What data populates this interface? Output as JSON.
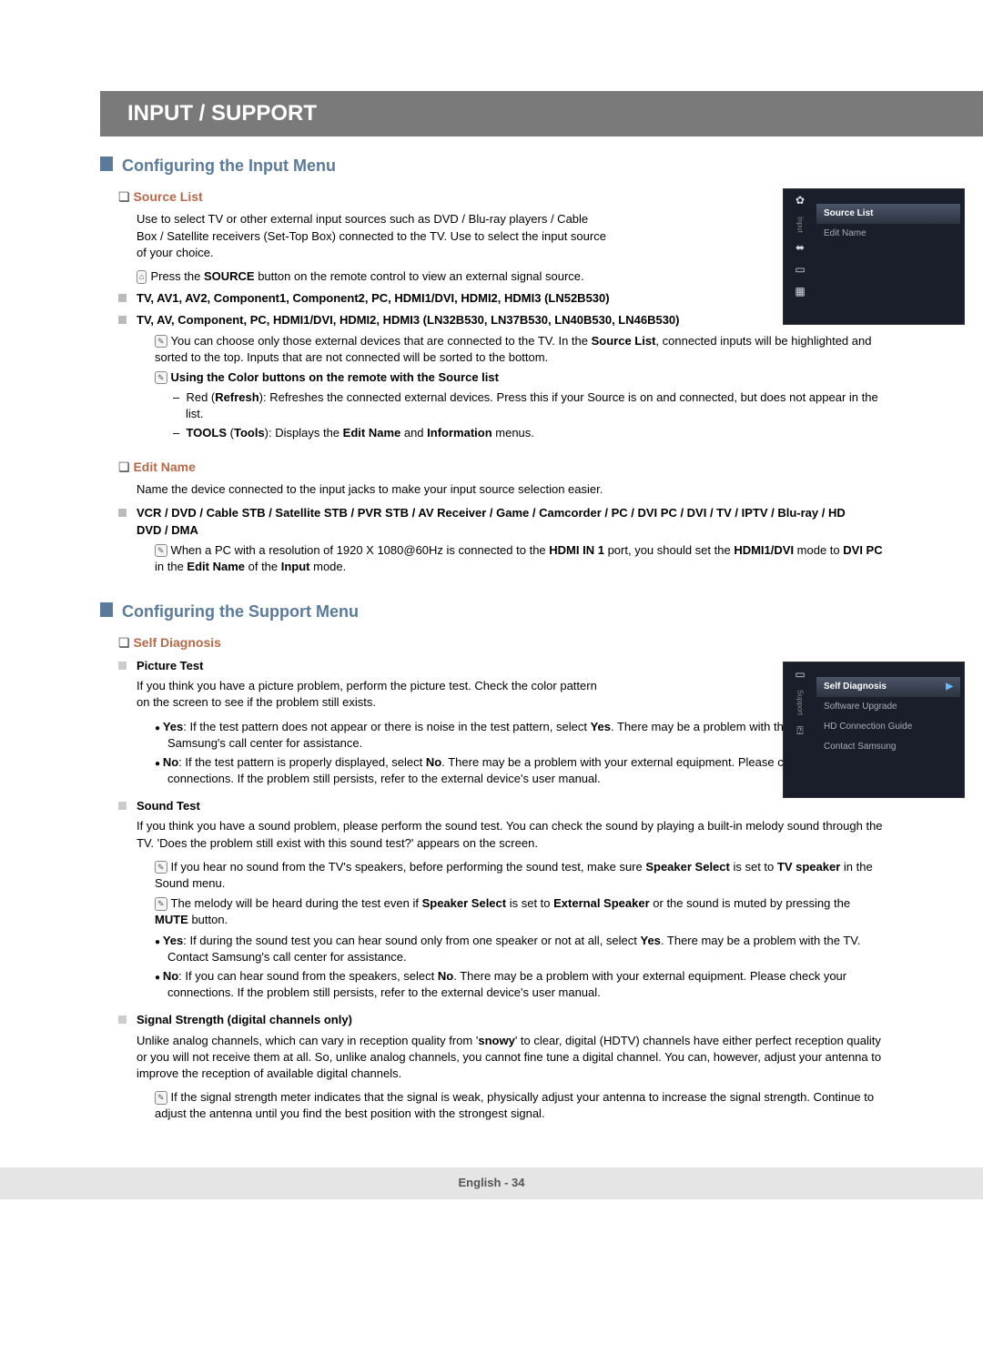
{
  "banner": "INPUT / SUPPORT",
  "section1": {
    "title": "Configuring the Input Menu",
    "source_list": {
      "head": "Source List",
      "desc": "Use to select TV or other external input sources such as DVD / Blu-ray players / Cable Box / Satellite receivers (Set-Top Box) connected to the TV. Use to select the input source of your choice.",
      "press_note": "Press the SOURCE button on the remote control to view an external signal source.",
      "list1": "TV, AV1, AV2, Component1, Component2, PC, HDMI1/DVI, HDMI2, HDMI3 (LN52B530)",
      "list2": "TV, AV, Component, PC, HDMI1/DVI, HDMI2, HDMI3 (LN32B530, LN37B530, LN40B530, LN46B530)",
      "note1": "You can choose only those external devices that are connected to the TV. In the Source List, connected inputs will be highlighted and sorted to the top. Inputs that are not connected will be sorted to the bottom.",
      "note2_head": "Using the Color buttons on the remote with the Source list",
      "dash1": "Red (Refresh): Refreshes the connected external devices. Press this if your Source is on and connected, but does not appear in the list.",
      "dash2": "TOOLS (Tools): Displays the Edit Name and Information menus."
    },
    "edit_name": {
      "head": "Edit Name",
      "desc": "Name the device connected to the input jacks to make your input source selection easier.",
      "list": "VCR / DVD / Cable STB / Satellite STB / PVR STB / AV Receiver / Game / Camcorder / PC / DVI PC / DVI / TV / IPTV / Blu-ray / HD DVD / DMA",
      "note": "When a PC with a resolution of 1920 X 1080@60Hz is connected to the HDMI IN 1 port, you should set the HDMI1/DVI mode to DVI PC in the Edit Name of the Input mode."
    },
    "osd1": {
      "vtab": "Input",
      "row1": "Source List",
      "row2": "Edit Name"
    }
  },
  "section2": {
    "title": "Configuring the Support Menu",
    "self_diag": {
      "head": "Self Diagnosis",
      "picture": {
        "head": "Picture Test",
        "desc": "If you think you have a picture problem, perform the picture test. Check the color pattern on the screen to see if the problem still exists.",
        "yes": "Yes: If the test pattern does not appear or there is noise in the test pattern, select Yes. There may be a problem with the TV. Contact Samsung's call center for assistance.",
        "no": "No: If the test pattern is properly displayed, select No. There may be a problem with your external equipment. Please check your connections. If the problem still persists, refer to the external device's user manual."
      },
      "sound": {
        "head": "Sound Test",
        "desc": "If you think you have a sound problem, please perform the sound test. You can check the sound by playing a built-in melody sound through the TV. 'Does the problem still exist with this sound test?' appears on the screen.",
        "note1": "If you hear no sound from the TV's speakers, before performing the sound test, make sure Speaker Select is set to TV speaker in the Sound menu.",
        "note2": "The melody will be heard during the test even if Speaker Select is set to External Speaker or the sound is muted by pressing the MUTE button.",
        "yes": "Yes: If during the sound test you can hear sound only from one speaker or not at all, select Yes. There may be a problem with the TV. Contact Samsung's call center for assistance.",
        "no": "No: If you can hear sound from the speakers, select No. There may be a problem with your external equipment. Please check your connections. If the problem still persists, refer to the external device's user manual."
      },
      "signal": {
        "head": "Signal Strength (digital channels only)",
        "desc": "Unlike analog channels, which can vary in reception quality from 'snowy' to clear, digital (HDTV) channels have either perfect reception quality or you will not receive them at all. So, unlike analog channels, you cannot fine tune a digital channel. You can, however, adjust your antenna to improve the reception of available digital channels.",
        "note": "If the signal strength meter indicates that the signal is weak, physically adjust your antenna to increase the signal strength. Continue to adjust the antenna until you find the best position with the strongest signal."
      }
    },
    "osd2": {
      "vtab": "Support",
      "row1": "Self Diagnosis",
      "row2": "Software Upgrade",
      "row3": "HD Connection Guide",
      "row4": "Contact Samsung"
    }
  },
  "footer": "English - 34"
}
